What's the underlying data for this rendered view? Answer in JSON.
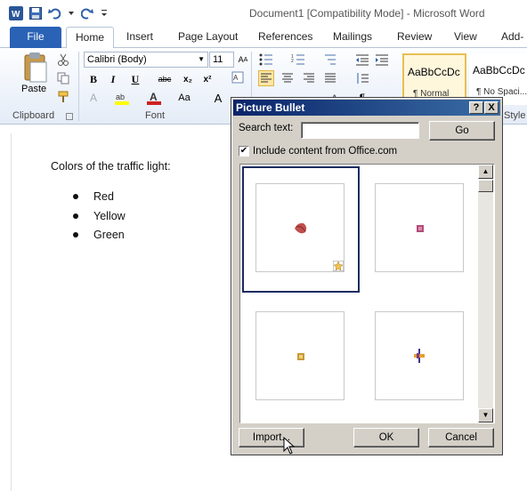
{
  "window": {
    "title": "Document1 [Compatibility Mode] - Microsoft Word"
  },
  "tabs": [
    {
      "label": "File"
    },
    {
      "label": "Home"
    },
    {
      "label": "Insert"
    },
    {
      "label": "Page Layout"
    },
    {
      "label": "References"
    },
    {
      "label": "Mailings"
    },
    {
      "label": "Review"
    },
    {
      "label": "View"
    },
    {
      "label": "Add-I"
    }
  ],
  "ribbon": {
    "paste_label": "Paste",
    "clipboard_label": "Clipboard",
    "font_label": "Font",
    "styles_label": "Style",
    "font_name": "Calibri (Body)",
    "font_size": "11",
    "style_normal_preview": "AaBbCcDc",
    "style_normal_name": "¶ Normal",
    "style_nospacing_preview": "AaBbCcDc",
    "style_nospacing_name": "¶ No Spaci..."
  },
  "document": {
    "heading": "Colors of the traffic light:",
    "bullets": [
      "Red",
      "Yellow",
      "Green"
    ]
  },
  "dialog": {
    "title": "Picture Bullet",
    "help": "?",
    "close": "X",
    "search_label": "Search text:",
    "search_value": "",
    "go_label": "Go",
    "include_label": "Include content from Office.com",
    "include_checked": "✔",
    "import_label": "Import...",
    "ok_label": "OK",
    "cancel_label": "Cancel"
  },
  "colors": {
    "accent": "#2a62b5",
    "dialog_bg": "#d4d0c8",
    "title_bar": "#0a246a"
  }
}
